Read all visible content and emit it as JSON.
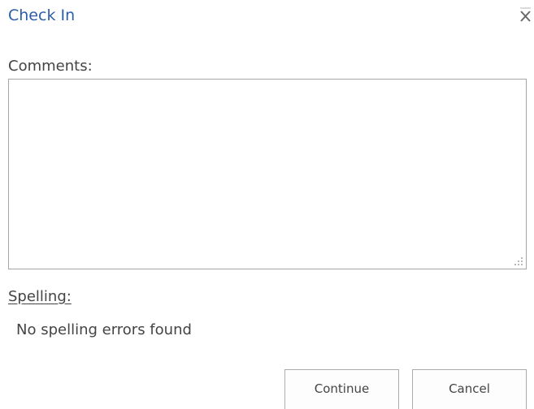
{
  "dialog": {
    "title": "Check In",
    "close_icon": "close-icon"
  },
  "comments": {
    "label": "Comments:",
    "value": "",
    "resize_icon": "resize-grip-icon"
  },
  "spelling": {
    "label": "Spelling:",
    "status": "No spelling errors found"
  },
  "buttons": {
    "continue_label": "Continue",
    "cancel_label": "Cancel"
  },
  "colors": {
    "title": "#2a5ea8",
    "text": "#444444",
    "border": "#a6a6a6"
  }
}
